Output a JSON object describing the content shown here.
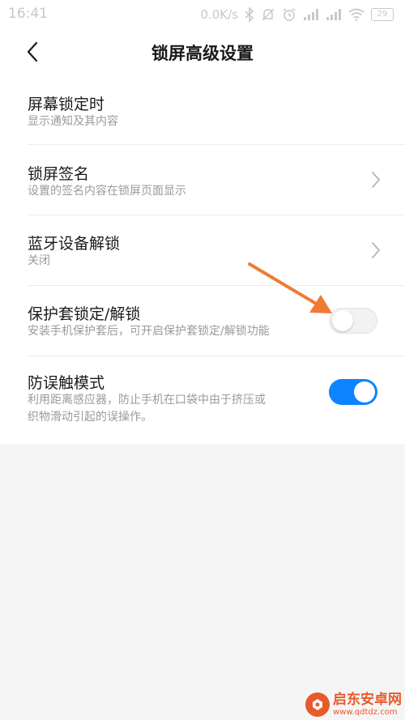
{
  "status_bar": {
    "time": "16:41",
    "network_speed": "0.0K/s",
    "battery": "29",
    "icons": [
      "bluetooth-icon",
      "dnd-icon",
      "alarm-icon",
      "signal-icon",
      "signal-icon",
      "wifi-icon",
      "battery-icon"
    ]
  },
  "header": {
    "back_icon": "chevron-left-icon",
    "title": "锁屏高级设置"
  },
  "settings": [
    {
      "title": "屏幕锁定时",
      "subtitle": "显示通知及其内容",
      "control": "none"
    },
    {
      "title": "锁屏签名",
      "subtitle": "设置的签名内容在锁屏页面显示",
      "control": "chevron"
    },
    {
      "title": "蓝牙设备解锁",
      "subtitle": "关闭",
      "control": "chevron"
    },
    {
      "title": "保护套锁定/解锁",
      "subtitle": "安装手机保护套后，可开启保护套锁定/解锁功能",
      "control": "switch",
      "enabled": false
    },
    {
      "title": "防误触模式",
      "subtitle_line1": "利用距离感应器，防止手机在口袋中由于挤压或",
      "subtitle_line2": "织物滑动引起的误操作。",
      "control": "switch",
      "enabled": true
    }
  ],
  "colors": {
    "accent": "#0d84ff",
    "annotation_arrow": "#f07a35",
    "watermark": "#e85a2a"
  },
  "watermark": {
    "name": "启东安卓网",
    "url": "www.qdtdz.com"
  }
}
